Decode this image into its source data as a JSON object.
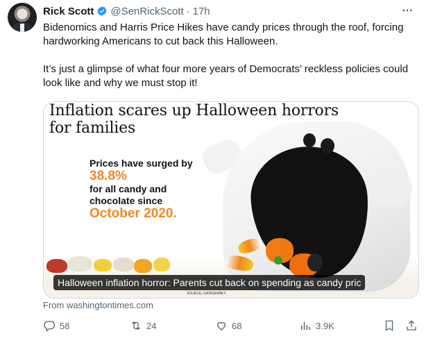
{
  "tweet": {
    "author_name": "Rick Scott",
    "handle": "@SenRickScott",
    "separator": "·",
    "time": "17h",
    "verified_color": "#1d9bf0",
    "paragraphs": [
      "Bidenomics and Harris Price Hikes have candy prices through the roof, forcing hardworking Americans to cut back this Halloween.",
      "It’s just a glimpse of what four more years of Democrats’ reckless policies could look like and why we must stop it!"
    ]
  },
  "card": {
    "headline": "Inflation scares up Halloween horrors for families",
    "stat_line1": "Prices have surged by",
    "stat_value": "38.8%",
    "stat_line2": "for all candy and",
    "stat_line3": "chocolate since",
    "stat_date": "October 2020.",
    "caption": "Halloween inflation horror: Parents cut back on spending as candy pric",
    "source": "SOURCE: DATASEMBLY",
    "from_text": "From washingtontimes.com",
    "accent_color": "#f5871f"
  },
  "actions": {
    "replies": "58",
    "reposts": "24",
    "likes": "68",
    "views": "3.9K",
    "icons": [
      "reply-icon",
      "repost-icon",
      "like-icon",
      "views-icon",
      "bookmark-icon",
      "share-icon"
    ]
  }
}
